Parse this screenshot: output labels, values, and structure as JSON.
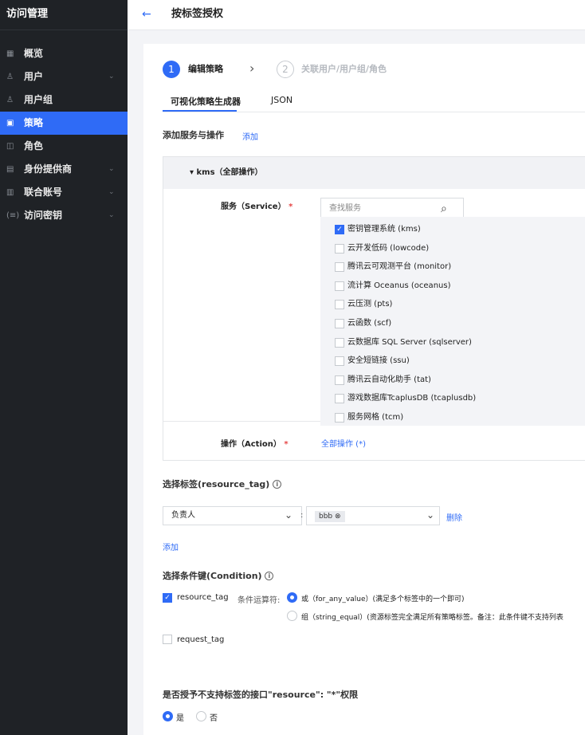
{
  "sidebar": {
    "title": "访问管理",
    "items": [
      {
        "label": "概览",
        "icon": "grid-icon",
        "glyph": "▦",
        "active": false,
        "chevron": false
      },
      {
        "label": "用户",
        "icon": "user-icon",
        "glyph": "♙",
        "active": false,
        "chevron": true
      },
      {
        "label": "用户组",
        "icon": "user-group-icon",
        "glyph": "♙",
        "active": false,
        "chevron": false
      },
      {
        "label": "策略",
        "icon": "policy-icon",
        "glyph": "▣",
        "active": true,
        "chevron": false
      },
      {
        "label": "角色",
        "icon": "role-icon",
        "glyph": "◫",
        "active": false,
        "chevron": false
      },
      {
        "label": "身份提供商",
        "icon": "identity-provider-icon",
        "glyph": "▤",
        "active": false,
        "chevron": true
      },
      {
        "label": "联合账号",
        "icon": "federated-account-icon",
        "glyph": "▥",
        "active": false,
        "chevron": true
      },
      {
        "label": "访问密钥",
        "icon": "key-icon",
        "glyph": "(≡)",
        "active": false,
        "chevron": true
      }
    ]
  },
  "header": {
    "back": "←",
    "title": "按标签授权"
  },
  "steps": [
    {
      "num": "1",
      "label": "编辑策略"
    },
    {
      "num": "2",
      "label": "关联用户/用户组/角色"
    }
  ],
  "step_sep": "›",
  "tabs": [
    "可视化策略生成器",
    "JSON"
  ],
  "service_section": {
    "title": "添加服务与操作",
    "add_link": "添加"
  },
  "service_box": {
    "header": "▾ kms（全部操作）",
    "service_label": "服务（Service）",
    "required_mark": "*",
    "search_placeholder": "查找服务",
    "services": [
      {
        "label": "密钥管理系统 (kms)",
        "checked": true
      },
      {
        "label": "云开发低码 (lowcode)",
        "checked": false
      },
      {
        "label": "腾讯云可观测平台 (monitor)",
        "checked": false
      },
      {
        "label": "流计算 Oceanus (oceanus)",
        "checked": false
      },
      {
        "label": "云压测 (pts)",
        "checked": false
      },
      {
        "label": "云函数 (scf)",
        "checked": false
      },
      {
        "label": "云数据库 SQL Server (sqlserver)",
        "checked": false
      },
      {
        "label": "安全短链接 (ssu)",
        "checked": false
      },
      {
        "label": "腾讯云自动化助手 (tat)",
        "checked": false
      },
      {
        "label": "游戏数据库TcaplusDB (tcaplusdb)",
        "checked": false
      },
      {
        "label": "服务网格 (tcm)",
        "checked": false
      }
    ],
    "action_label": "操作（Action）",
    "action_value": "全部操作 (*)"
  },
  "tag_section": {
    "title": "选择标签(resource_tag)",
    "tag_key": "负责人",
    "colon": ":",
    "tag_value": "bbb",
    "delete": "删除",
    "add": "添加"
  },
  "condition_section": {
    "title": "选择条件键(Condition)",
    "resource_tag": "resource_tag",
    "operator_label": "条件运算符:",
    "option_or": "或（for_any_value）(满足多个标签中的一个即可)",
    "option_and": "组（string_equal）(资源标签完全满足所有策略标签。备注：此条件键不支持列表",
    "request_tag": "request_tag"
  },
  "grant_section": {
    "title": "是否授予不支持标签的接口\"resource\": \"*\"权限",
    "yes": "是",
    "no": "否"
  },
  "icons": {
    "info": "i",
    "search": "⌕",
    "chevron": "⌄",
    "check": "✓",
    "chip_close": "⊗"
  }
}
